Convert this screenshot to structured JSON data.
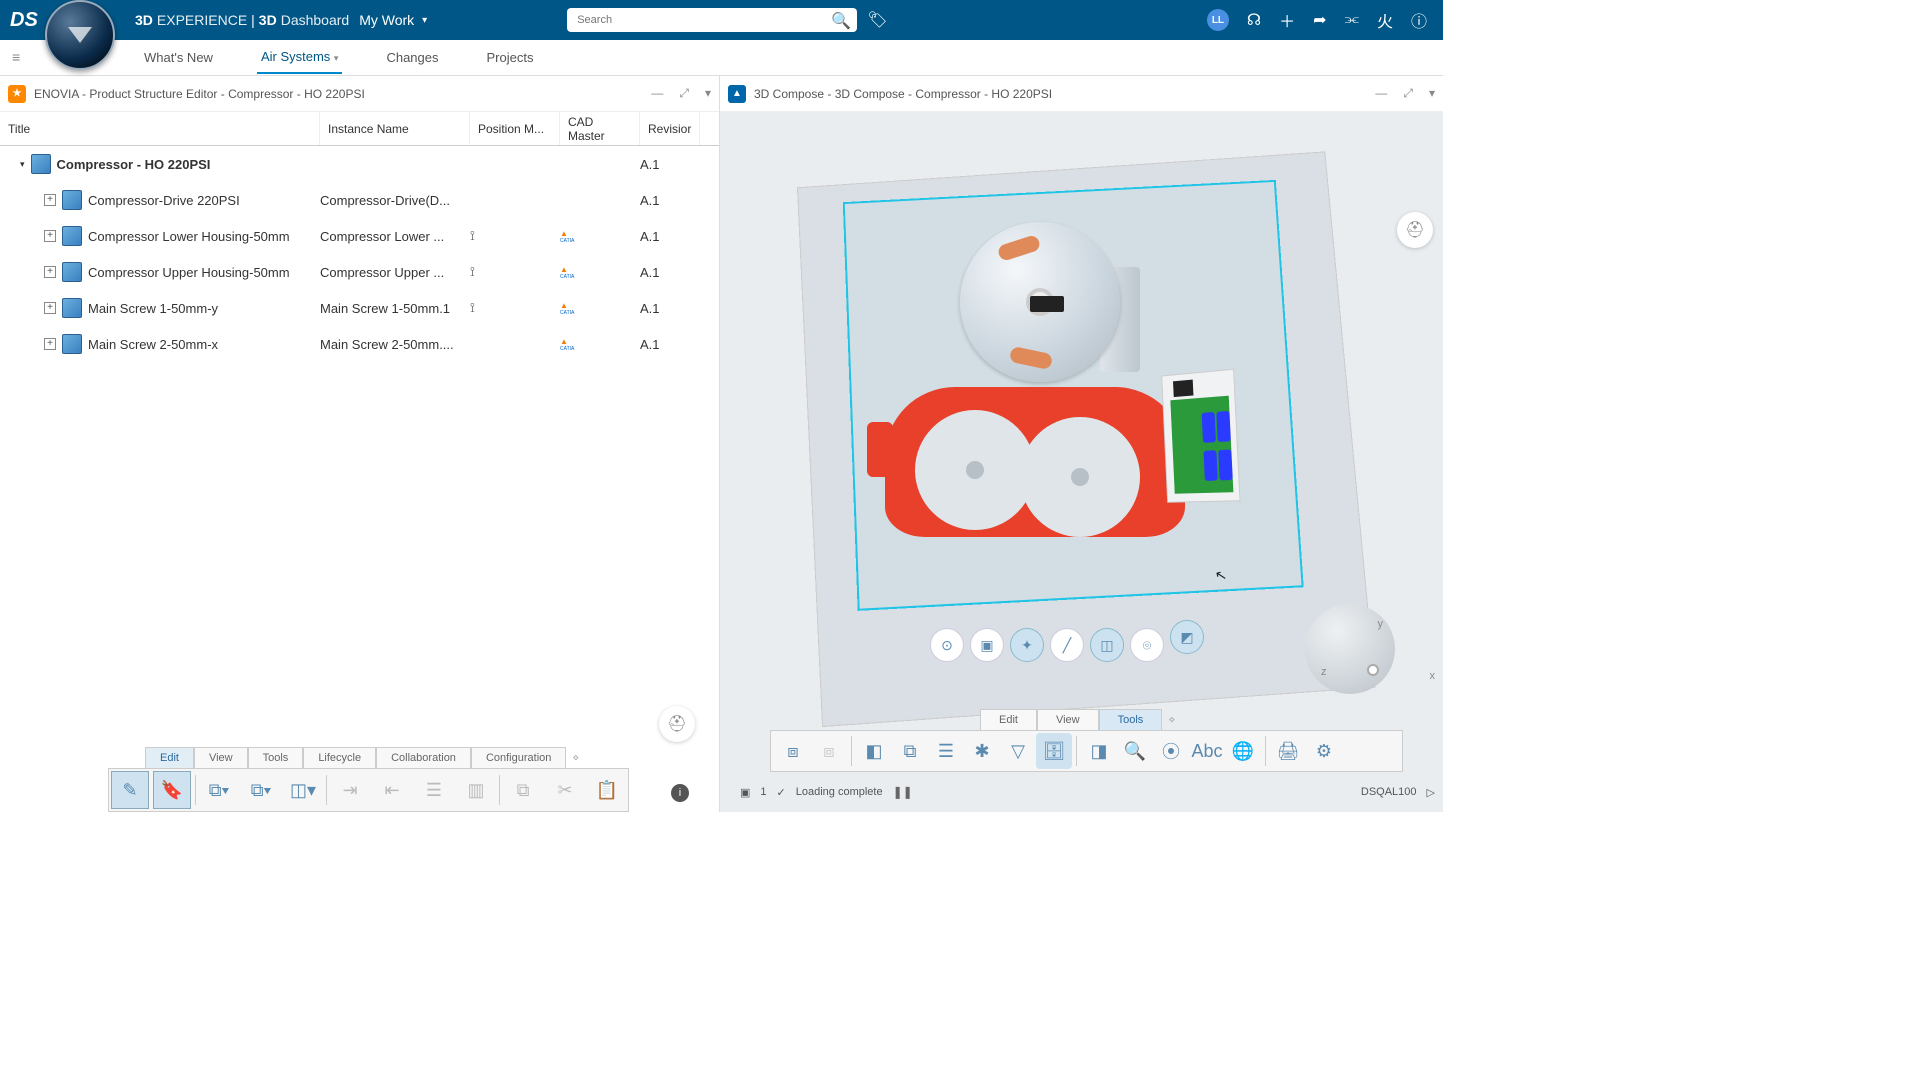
{
  "topbar": {
    "brand_bold": "3D",
    "brand_light": "EXPERIENCE",
    "divider": " | ",
    "dash_bold": "3D",
    "dash_light": "Dashboard",
    "context": "My Work",
    "search_placeholder": "Search",
    "avatar_initials": "LL"
  },
  "nav": {
    "items": [
      "What's New",
      "Air Systems",
      "Changes",
      "Projects"
    ],
    "active_index": 1
  },
  "left_panel": {
    "title": "ENOVIA - Product Structure Editor - Compressor - HO 220PSI",
    "columns": [
      "Title",
      "Instance Name",
      "Position M...",
      "CAD Master",
      "Revisior"
    ],
    "rows": [
      {
        "indent": 0,
        "expander": "▾",
        "title": "Compressor - HO 220PSI",
        "instance": "",
        "pos": "",
        "cad": "globe",
        "rev": "A.1"
      },
      {
        "indent": 1,
        "expander": "+",
        "title": "Compressor-Drive 220PSI",
        "instance": "Compressor-Drive(D...",
        "pos": "",
        "cad": "sw",
        "rev": "A.1"
      },
      {
        "indent": 1,
        "expander": "+",
        "title": "Compressor Lower Housing-50mm",
        "instance": "Compressor Lower ...",
        "pos": "⟟",
        "cad": "catia",
        "rev": "A.1"
      },
      {
        "indent": 1,
        "expander": "+",
        "title": "Compressor Upper Housing-50mm",
        "instance": "Compressor Upper ...",
        "pos": "⟟",
        "cad": "catia",
        "rev": "A.1"
      },
      {
        "indent": 1,
        "expander": "+",
        "title": "Main Screw 1-50mm-y",
        "instance": "Main Screw 1-50mm.1",
        "pos": "⟟",
        "cad": "catia",
        "rev": "A.1"
      },
      {
        "indent": 1,
        "expander": "+",
        "title": "Main Screw 2-50mm-x",
        "instance": "Main Screw 2-50mm....",
        "pos": "",
        "cad": "catia",
        "rev": "A.1"
      }
    ],
    "tabs": [
      "Edit",
      "View",
      "Tools",
      "Lifecycle",
      "Collaboration",
      "Configuration"
    ],
    "active_tab": 0
  },
  "right_panel": {
    "title": "3D Compose - 3D Compose - Compressor - HO 220PSI",
    "tabs": [
      "Edit",
      "View",
      "Tools"
    ],
    "active_tab": 2,
    "axes": {
      "x": "x",
      "y": "y",
      "z": "z"
    },
    "status": {
      "count": "1",
      "message": "Loading complete",
      "server": "DSQAL100"
    }
  }
}
